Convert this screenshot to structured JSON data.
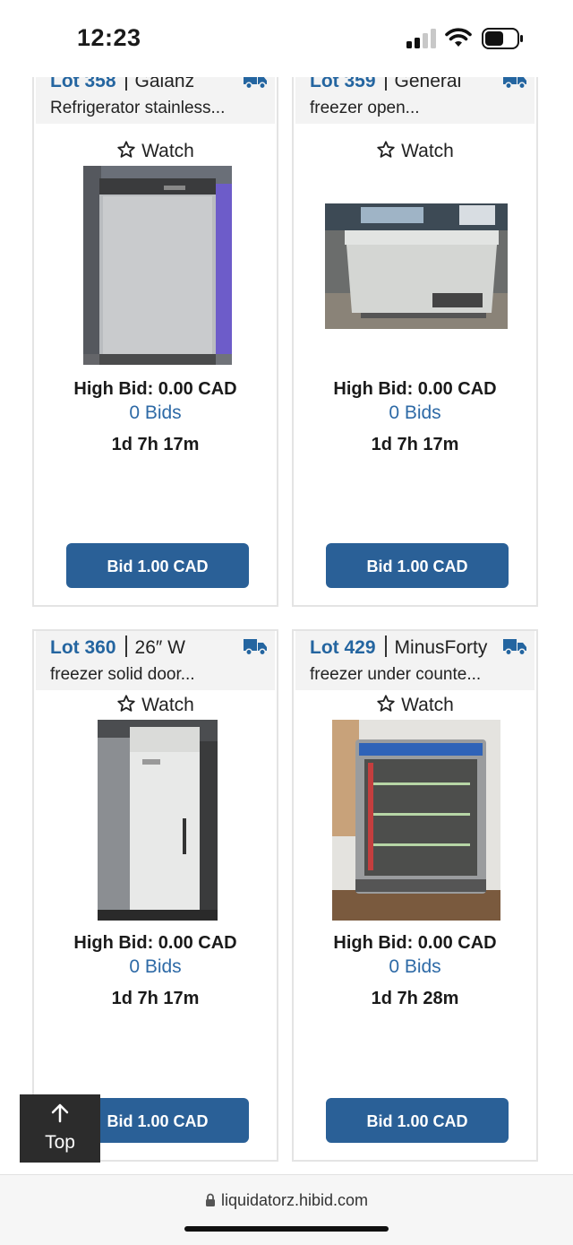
{
  "status": {
    "time": "12:23"
  },
  "lots": [
    {
      "lot": "Lot 358",
      "brand": "Galanz",
      "title": "Refrigerator stainless...",
      "watch": "Watch",
      "high_bid": "High Bid: 0.00 CAD",
      "bids": "0 Bids",
      "time_left": "1d 7h 17m",
      "bid_button": "Bid 1.00 CAD"
    },
    {
      "lot": "Lot 359",
      "brand": "General",
      "title": "freezer open...",
      "watch": "Watch",
      "high_bid": "High Bid: 0.00 CAD",
      "bids": "0 Bids",
      "time_left": "1d 7h 17m",
      "bid_button": "Bid 1.00 CAD"
    },
    {
      "lot": "Lot 360",
      "brand": "26″ W",
      "title": "freezer solid door...",
      "watch": "Watch",
      "high_bid": "High Bid: 0.00 CAD",
      "bids": "0 Bids",
      "time_left": "1d 7h 17m",
      "bid_button": "Bid 1.00 CAD"
    },
    {
      "lot": "Lot 429",
      "brand": "MinusForty",
      "title": "freezer under counte...",
      "watch": "Watch",
      "high_bid": "High Bid: 0.00 CAD",
      "bids": "0 Bids",
      "time_left": "1d 7h 28m",
      "bid_button": "Bid 1.00 CAD"
    }
  ],
  "top_button": {
    "label": "Top"
  },
  "browser": {
    "url": "liquidatorz.hibid.com"
  },
  "colors": {
    "lot_link": "#2465a0",
    "bid_button": "#2a6097",
    "bids_link": "#2e6aa6"
  }
}
